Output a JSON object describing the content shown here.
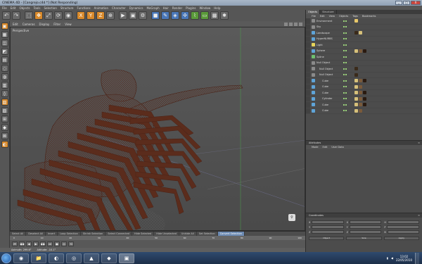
{
  "window": {
    "title": "CINEMA 4D - [Cangrejo.c4d *] (Not Responding)",
    "controls": [
      "_",
      "□",
      "X"
    ]
  },
  "menubar": [
    "File",
    "Edit",
    "Objects",
    "Tools",
    "Selection",
    "Structure",
    "Functions",
    "Animation",
    "Character",
    "Dynamics",
    "MoGraph",
    "Hair",
    "Render",
    "Plugins",
    "Window",
    "Help"
  ],
  "toolbar": {
    "icons": [
      "undo-icon",
      "redo-icon",
      "live-select-icon",
      "move-icon",
      "scale-icon",
      "rotate-icon",
      "recent-icon",
      "x-axis-icon",
      "y-axis-icon",
      "z-axis-icon",
      "coordinate-system-icon",
      "render-view-icon",
      "render-picture-icon",
      "edit-render-settings-icon",
      "cube-icon",
      "pen-icon",
      "subdivide-icon",
      "array-icon",
      "deformer-icon",
      "floor-icon",
      "camera-icon",
      "light-icon"
    ],
    "glyphs": [
      "↶",
      "↷",
      "⬚",
      "✥",
      "⤢",
      "⟳",
      "◉",
      "X",
      "Y",
      "Z",
      "⊕",
      "▶",
      "▣",
      "⚙",
      "■",
      "✎",
      "◈",
      "✣",
      "⌇",
      "▭",
      "▩",
      "✱"
    ]
  },
  "left_tools": [
    "▣",
    "▦",
    "◫",
    "◩",
    "▤",
    "◌",
    "◍",
    "▥",
    "◊",
    "▧",
    "▨",
    "⊞",
    "◆",
    "⊠",
    "◐"
  ],
  "viewport": {
    "menu": [
      "Edit",
      "Cameras",
      "Display",
      "Filter",
      "View"
    ],
    "label": "Perspective",
    "axis_label": "⚲"
  },
  "timeline": {
    "modes": [
      "Select All",
      "Deselect All",
      "Invert",
      "Loop Selection",
      "Shrink Selection",
      "Select Connected",
      "Hide Selected",
      "Hide Unselected",
      "Unhide All",
      "Set Selection",
      "Convert Selection"
    ],
    "active_mode": 10,
    "ruler": [
      "0",
      "10",
      "20",
      "30",
      "40",
      "50",
      "60",
      "70",
      "80",
      "90",
      "100"
    ],
    "controls": [
      "⏮",
      "◀◀",
      "◀",
      "▶",
      "▶▶",
      "⏭",
      "●",
      "◎",
      "⟲"
    ]
  },
  "status": {
    "left": "Azimuth: 299.6°",
    "mid": "Altitude: -10.1°"
  },
  "objects_panel": {
    "tabs": [
      "Objects",
      "Structure"
    ],
    "menu": [
      "File",
      "Edit",
      "View",
      "Objects",
      "Tags",
      "Bookmarks"
    ],
    "rows": [
      {
        "name": "Environment",
        "type": "null",
        "tags": [
          "#e8c86a"
        ]
      },
      {
        "name": "Sky",
        "type": "null",
        "tags": []
      },
      {
        "name": "Landscape",
        "type": "mesh",
        "tags": [
          "#3a2a1a",
          "#d6c07a"
        ]
      },
      {
        "name": "HyperNURBS",
        "type": "mesh",
        "tags": []
      },
      {
        "name": "Light",
        "type": "light",
        "tags": []
      },
      {
        "name": "Sphere",
        "type": "mesh",
        "tags": [
          "#d6c07a",
          "#7a5a3a",
          "#2a1a10"
        ]
      },
      {
        "name": "Spline",
        "type": "spline",
        "tags": []
      },
      {
        "name": "Null Object",
        "type": "null",
        "tags": []
      },
      {
        "name": "Null Object",
        "type": "null",
        "tags": [
          "#3a2a1a"
        ]
      },
      {
        "name": "Null Object",
        "type": "null",
        "tags": [
          "#3a2a1a"
        ]
      },
      {
        "name": "Cube",
        "type": "mesh",
        "tags": [
          "#d6c07a",
          "#7a5a3a",
          "#2a1a10"
        ]
      },
      {
        "name": "Cube",
        "type": "mesh",
        "tags": [
          "#d6c07a",
          "#7a5a3a"
        ]
      },
      {
        "name": "Cube",
        "type": "mesh",
        "tags": [
          "#d6c07a",
          "#7a5a3a",
          "#2a1a10"
        ]
      },
      {
        "name": "Cylinder",
        "type": "mesh",
        "tags": [
          "#d6c07a",
          "#7a5a3a",
          "#2a1a10"
        ]
      },
      {
        "name": "Cube",
        "type": "mesh",
        "tags": [
          "#d6c07a",
          "#7a5a3a",
          "#2a1a10"
        ]
      },
      {
        "name": "Cube",
        "type": "mesh",
        "tags": [
          "#d6c07a",
          "#7a5a3a"
        ]
      }
    ]
  },
  "attributes_panel": {
    "title": "Attributes",
    "menu": [
      "Mode",
      "Edit",
      "User Data"
    ]
  },
  "coordinates_panel": {
    "title": "Coordinates",
    "rows": [
      [
        "X",
        "X",
        "H"
      ],
      [
        "Y",
        "Y",
        "P"
      ],
      [
        "Z",
        "Z",
        "B"
      ]
    ],
    "dropdowns": [
      "Object",
      "Size",
      "Apply"
    ]
  },
  "taskbar": {
    "apps": [
      "◉",
      "📁",
      "◐",
      "◎",
      "▲",
      "◆",
      "▣"
    ],
    "active_index": 6,
    "time": "13:02",
    "date": "22/05/2010"
  },
  "colors": {
    "accent": "#d98a2b",
    "wireframe": "#5a2a1a",
    "viewport_bg": "#545454",
    "selection_blue": "#6c8ab2"
  }
}
